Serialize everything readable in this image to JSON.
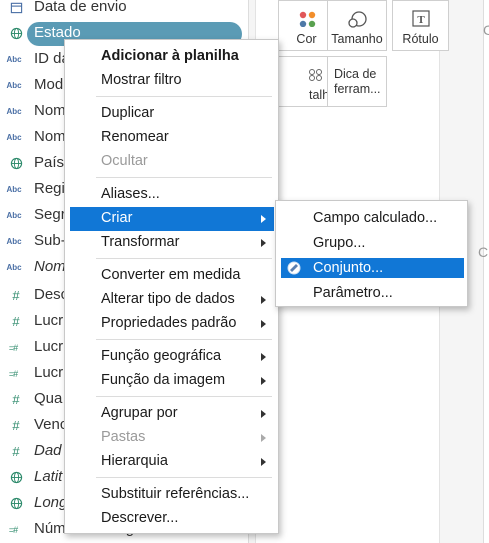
{
  "data_pane": {
    "fields": [
      {
        "icon": "calendar-icon",
        "type": "date",
        "name": "Data de envio",
        "italic": false
      },
      {
        "icon": "globe-icon",
        "type": "geo",
        "name": "Estado",
        "italic": false,
        "selected": true
      },
      {
        "icon": "abc-icon",
        "type": "abc",
        "name": "ID da",
        "italic": false
      },
      {
        "icon": "abc-icon",
        "type": "abc",
        "name": "Mod",
        "italic": false
      },
      {
        "icon": "abc-icon",
        "type": "abc",
        "name": "Nom",
        "italic": false
      },
      {
        "icon": "abc-icon",
        "type": "abc",
        "name": "Nom",
        "italic": false
      },
      {
        "icon": "globe-icon",
        "type": "geo",
        "name": "País",
        "italic": false
      },
      {
        "icon": "abc-icon",
        "type": "abc",
        "name": "Regi",
        "italic": false
      },
      {
        "icon": "abc-icon",
        "type": "abc",
        "name": "Segr",
        "italic": false
      },
      {
        "icon": "abc-icon",
        "type": "abc",
        "name": "Sub-",
        "italic": false
      },
      {
        "icon": "abc-icon",
        "type": "abc",
        "name": "Nom",
        "italic": true
      },
      {
        "icon": "hash-icon",
        "type": "hash",
        "name": "Desc",
        "italic": false
      },
      {
        "icon": "hash-icon",
        "type": "hash",
        "name": "Lucr",
        "italic": false
      },
      {
        "icon": "calc-icon",
        "type": "calc",
        "name": "Lucr",
        "italic": false
      },
      {
        "icon": "calc-icon",
        "type": "calc",
        "name": "Lucr",
        "italic": false
      },
      {
        "icon": "hash-icon",
        "type": "hash",
        "name": "Qua",
        "italic": false
      },
      {
        "icon": "hash-icon",
        "type": "hash",
        "name": "Venc",
        "italic": false
      },
      {
        "icon": "hash-icon",
        "type": "hash",
        "name": "Dad",
        "italic": true
      },
      {
        "icon": "globe-icon",
        "type": "geo",
        "name": "Latit",
        "italic": true
      },
      {
        "icon": "globe-icon",
        "type": "geo",
        "name": "Long",
        "italic": true
      },
      {
        "icon": "calc-icon",
        "type": "calc",
        "name": "Número de registros",
        "italic": false
      }
    ]
  },
  "marks": {
    "buttons": [
      {
        "label": "Cor",
        "icon": "color-dots-icon"
      },
      {
        "label": "Tamanho",
        "icon": "size-icon"
      },
      {
        "label": "Rótulo",
        "icon": "label-T-icon"
      },
      {
        "label": "talhe",
        "icon": "detail-dots-icon"
      },
      {
        "label": "Dica de ferram...",
        "icon": "tooltip-icon"
      }
    ],
    "edge_text_1": "C",
    "edge_text_2": "Cid"
  },
  "context_menu": {
    "items": [
      {
        "label": "Adicionar à planilha",
        "bold": true
      },
      {
        "label": "Mostrar filtro"
      },
      {
        "sep": true
      },
      {
        "label": "Duplicar"
      },
      {
        "label": "Renomear"
      },
      {
        "label": "Ocultar",
        "disabled": true
      },
      {
        "sep": true
      },
      {
        "label": "Aliases..."
      },
      {
        "label": "Criar",
        "submenu": true,
        "active": true
      },
      {
        "label": "Transformar",
        "submenu": true
      },
      {
        "sep": true
      },
      {
        "label": "Converter em medida"
      },
      {
        "label": "Alterar tipo de dados",
        "submenu": true
      },
      {
        "label": "Propriedades padrão",
        "submenu": true
      },
      {
        "sep": true
      },
      {
        "label": "Função geográfica",
        "submenu": true
      },
      {
        "label": "Função da imagem",
        "submenu": true
      },
      {
        "sep": true
      },
      {
        "label": "Agrupar por",
        "submenu": true
      },
      {
        "label": "Pastas",
        "submenu": true,
        "disabled": true
      },
      {
        "label": "Hierarquia",
        "submenu": true
      },
      {
        "sep": true
      },
      {
        "label": "Substituir referências..."
      },
      {
        "label": "Descrever..."
      }
    ]
  },
  "submenu": {
    "items": [
      {
        "label": "Campo calculado..."
      },
      {
        "label": "Grupo..."
      },
      {
        "label": "Conjunto...",
        "active": true,
        "icon": "set-icon"
      },
      {
        "label": "Parâmetro..."
      }
    ]
  },
  "colors": {
    "selection_pill": "#5b9bb5",
    "menu_highlight": "#1177d6",
    "dim_geo": "#2d8a6b",
    "dim_abc": "#4a6fa5"
  }
}
